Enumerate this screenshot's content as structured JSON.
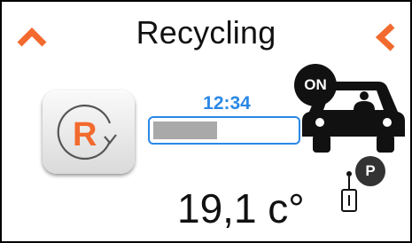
{
  "header": {
    "title": "Recycling",
    "up_icon": "chevron-up-icon",
    "back_icon": "chevron-left-icon"
  },
  "recycle": {
    "icon": "recycle-r-icon",
    "letter": "R"
  },
  "timer": {
    "time": "12:34",
    "progress": 0.45
  },
  "vehicle": {
    "icon": "car-with-driver-icon",
    "status": "ON"
  },
  "climate": {
    "temperature": "19,1 c°"
  },
  "key": {
    "icon": "key-fob-icon",
    "park_label": "P"
  },
  "colors": {
    "accent_orange": "#f26a2e",
    "timer_blue": "#2a88e6",
    "progress_fill": "#a9a9a9",
    "text": "#111111"
  }
}
